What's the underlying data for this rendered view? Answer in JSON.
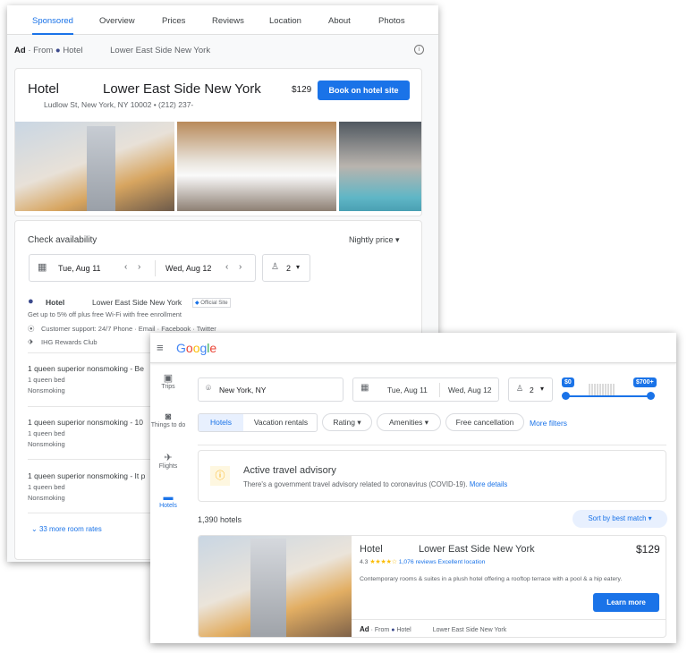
{
  "listing": {
    "tabs": [
      "Sponsored",
      "Overview",
      "Prices",
      "Reviews",
      "Location",
      "About",
      "Photos"
    ],
    "ad_label": "Ad",
    "from_label": "· From",
    "brand": "Hotel",
    "location_name": "Lower East Side New York",
    "hotel_title": "Hotel",
    "hotel_name": "Lower East Side New York",
    "address": "Ludlow St, New York, NY 10002 • (212) 237-",
    "price": "$129",
    "book_label": "Book on hotel site",
    "check_title": "Check availability",
    "nightly_label": "Nightly price",
    "checkin": "Tue, Aug 11",
    "checkout": "Wed, Aug 12",
    "guests": "2",
    "provider_brand": "Hotel",
    "provider_name": "Lower East Side New York",
    "official_badge": "Official Site",
    "promo": "Get up to 5% off plus free Wi-Fi with free enrollment",
    "support": "Customer support: 24/7 Phone · Email · Facebook · Twitter",
    "rewards": "IHG Rewards Club",
    "rooms": [
      {
        "name": "1 queen superior nonsmoking - Be",
        "bed": "1 queen bed",
        "smoking": "Nonsmoking"
      },
      {
        "name": "1 queen superior nonsmoking - 10",
        "bed": "1 queen bed",
        "smoking": "Nonsmoking"
      },
      {
        "name": "1 queen superior nonsmoking - It p",
        "bed": "1 queen bed",
        "smoking": "Nonsmoking"
      }
    ],
    "more_rates": "33 more room rates"
  },
  "search": {
    "logo": "Google",
    "nav": [
      "Trips",
      "Things to do",
      "Flights",
      "Hotels"
    ],
    "location": "New York, NY",
    "checkin": "Tue, Aug 11",
    "checkout": "Wed, Aug 12",
    "guests": "2",
    "price_min": "$0",
    "price_max": "$700+",
    "filters": {
      "hotels": "Hotels",
      "vacation": "Vacation rentals",
      "rating": "Rating",
      "amenities": "Amenities",
      "free_cancel": "Free cancellation",
      "more": "More filters"
    },
    "advisory_title": "Active travel advisory",
    "advisory_text": "There's a government travel advisory related to coronavirus (COVID-19).",
    "advisory_link": "More details",
    "count": "1,390 hotels",
    "sort": "Sort by best match",
    "result": {
      "title": "Hotel",
      "name": "Lower East Side New York",
      "price": "$129",
      "rating": "4.3",
      "stars": 4.3,
      "reviews": "1,076 reviews",
      "tag": "Excellent location",
      "description": "Contemporary rooms & suites in a plush hotel offering a rooftop terrace with a pool & a hip eatery.",
      "learn_more": "Learn more",
      "ad": "Ad",
      "from": "· From",
      "brand": "Hotel",
      "location_name": "Lower East Side New York"
    }
  },
  "colors": {
    "accent": "#1a73e8",
    "star": "#fbbc04",
    "advisory": "#f9ab00"
  }
}
